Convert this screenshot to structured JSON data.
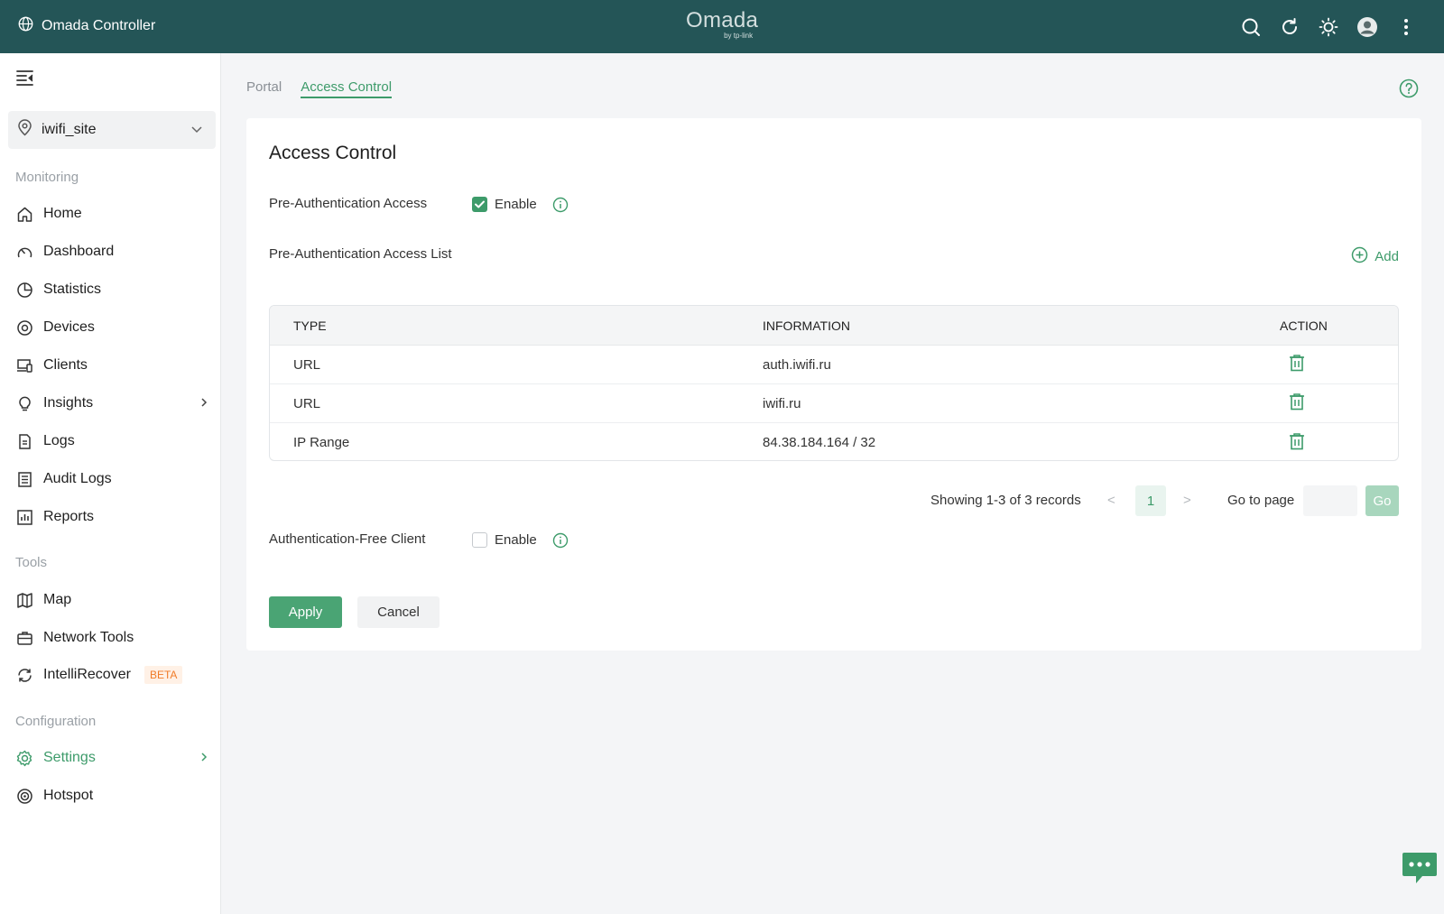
{
  "app": {
    "title": "Omada Controller",
    "logo_main": "Omada",
    "logo_sub": "by tp-link"
  },
  "topbar": {
    "icons": [
      "search-icon",
      "refresh-icon",
      "theme-sun-icon",
      "avatar",
      "more-vert-icon"
    ]
  },
  "sidebar": {
    "site": "iwifi_site",
    "monitoring_label": "Monitoring",
    "tools_label": "Tools",
    "configuration_label": "Configuration",
    "monitoring": [
      {
        "label": "Home",
        "icon": "home-icon"
      },
      {
        "label": "Dashboard",
        "icon": "dashboard-icon"
      },
      {
        "label": "Statistics",
        "icon": "statistics-icon"
      },
      {
        "label": "Devices",
        "icon": "devices-icon"
      },
      {
        "label": "Clients",
        "icon": "clients-icon"
      },
      {
        "label": "Insights",
        "icon": "insights-icon"
      },
      {
        "label": "Logs",
        "icon": "logs-icon"
      },
      {
        "label": "Audit Logs",
        "icon": "audit-logs-icon"
      },
      {
        "label": "Reports",
        "icon": "reports-icon"
      }
    ],
    "tools": [
      {
        "label": "Map",
        "icon": "map-icon"
      },
      {
        "label": "Network Tools",
        "icon": "network-tools-icon"
      },
      {
        "label": "IntelliRecover",
        "icon": "intellirecover-icon",
        "badge": "BETA"
      }
    ],
    "configuration": [
      {
        "label": "Settings",
        "icon": "settings-icon"
      },
      {
        "label": "Hotspot",
        "icon": "hotspot-icon"
      }
    ]
  },
  "tabs": [
    {
      "label": "Portal",
      "active": false
    },
    {
      "label": "Access Control",
      "active": true
    }
  ],
  "card": {
    "title": "Access Control",
    "pre_auth_label": "Pre-Authentication Access",
    "pre_auth_enable_label": "Enable",
    "pre_auth_enabled": true,
    "pre_auth_list_label": "Pre-Authentication Access List",
    "add_label": "Add",
    "auth_free_label": "Authentication-Free Client",
    "auth_free_enable_label": "Enable",
    "auth_free_enabled": false
  },
  "table": {
    "headers": [
      "TYPE",
      "INFORMATION",
      "ACTION"
    ],
    "rows": [
      {
        "type": "URL",
        "info": "auth.iwifi.ru"
      },
      {
        "type": "URL",
        "info": "iwifi.ru"
      },
      {
        "type": "IP Range",
        "info": "84.38.184.164 / 32"
      }
    ]
  },
  "pager": {
    "records": "Showing 1-3 of 3 records",
    "prev": "<",
    "current_page": "1",
    "next": ">",
    "goto_label": "Go to page",
    "goto_value": "",
    "go_label": "Go"
  },
  "buttons": {
    "apply": "Apply",
    "cancel": "Cancel"
  },
  "colors": {
    "topbar": "#245557",
    "accent": "#3d9b6a",
    "beta": "#f07b28"
  }
}
